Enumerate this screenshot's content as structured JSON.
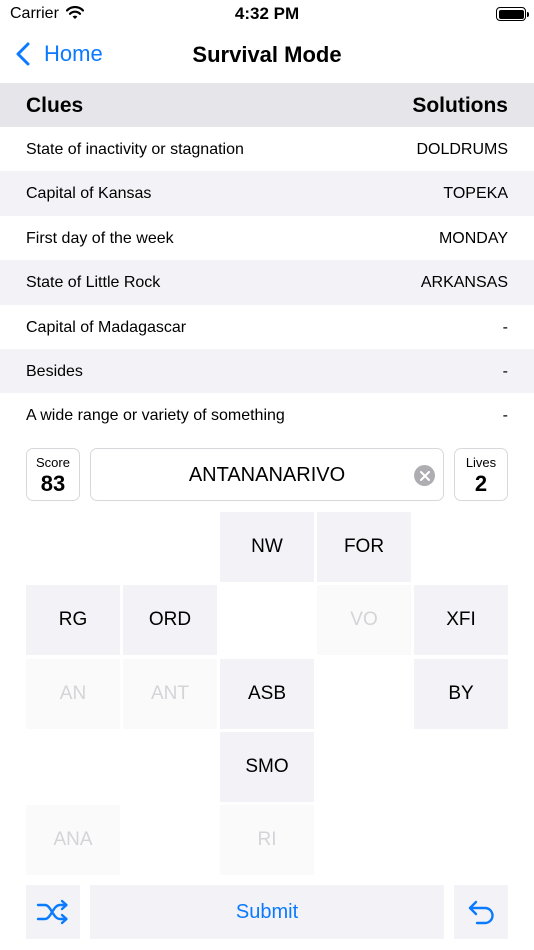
{
  "status_bar": {
    "carrier": "Carrier",
    "time": "4:32 PM"
  },
  "nav": {
    "back_label": "Home",
    "title": "Survival Mode"
  },
  "table": {
    "header_clues": "Clues",
    "header_solutions": "Solutions",
    "rows": [
      {
        "clue": "State of inactivity or stagnation",
        "solution": "DOLDRUMS"
      },
      {
        "clue": "Capital of Kansas",
        "solution": "TOPEKA"
      },
      {
        "clue": "First day of the week",
        "solution": "MONDAY"
      },
      {
        "clue": "State of Little Rock",
        "solution": "ARKANSAS"
      },
      {
        "clue": "Capital of Madagascar",
        "solution": "-"
      },
      {
        "clue": "Besides",
        "solution": "-"
      },
      {
        "clue": "A wide range or variety of something",
        "solution": "-"
      }
    ]
  },
  "score": {
    "label": "Score",
    "value": "83"
  },
  "answer": {
    "value": "ANTANANARIVO"
  },
  "lives": {
    "label": "Lives",
    "value": "2"
  },
  "tiles": [
    {
      "label": "NW",
      "used": false
    },
    {
      "label": "FOR",
      "used": false
    },
    {
      "label": "RG",
      "used": false
    },
    {
      "label": "ORD",
      "used": false
    },
    {
      "label": "VO",
      "used": true
    },
    {
      "label": "XFI",
      "used": false
    },
    {
      "label": "AN",
      "used": true
    },
    {
      "label": "ANT",
      "used": true
    },
    {
      "label": "ASB",
      "used": false
    },
    {
      "label": "BY",
      "used": false
    },
    {
      "label": "SMO",
      "used": false
    },
    {
      "label": "ANA",
      "used": true
    },
    {
      "label": "RI",
      "used": true
    }
  ],
  "controls": {
    "submit_label": "Submit",
    "shuffle_icon": "shuffle-icon",
    "undo_icon": "undo-icon"
  },
  "colors": {
    "accent": "#0a7aff",
    "tile": "#f2f2f7",
    "used_text": "#d4d4d8"
  }
}
